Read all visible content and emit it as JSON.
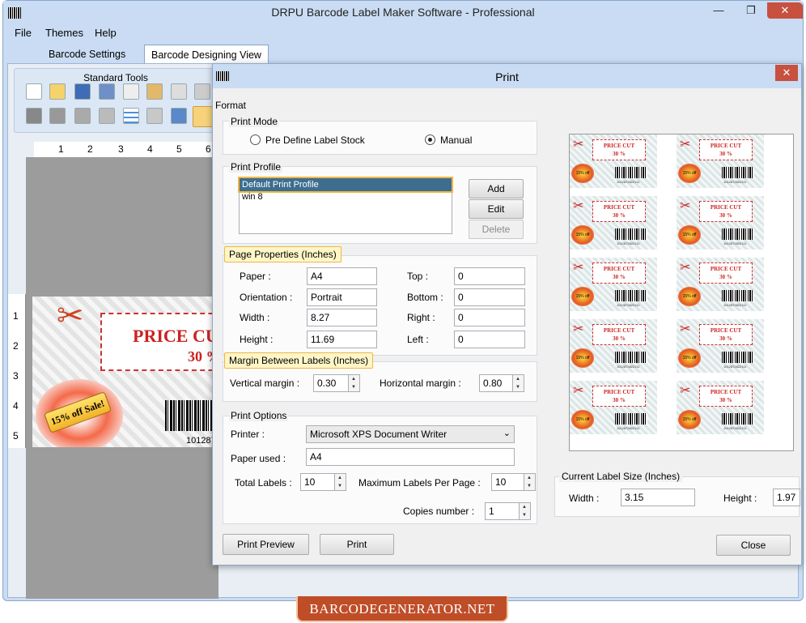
{
  "window": {
    "title": "DRPU Barcode Label Maker Software - Professional",
    "minimize": "—",
    "maximize": "❐",
    "close": "✕"
  },
  "menu": [
    "File",
    "Themes",
    "Help"
  ],
  "tabs": [
    "Barcode Settings",
    "Barcode Designing View"
  ],
  "toolbox": {
    "title": "Standard Tools"
  },
  "ruler": {
    "h": [
      "1",
      "2",
      "3",
      "4",
      "5",
      "6"
    ],
    "v": [
      "1",
      "2",
      "3",
      "4",
      "5"
    ]
  },
  "label_design": {
    "price_text": "PRICE CU",
    "percent": "30 %",
    "badge": "15% off Sale!",
    "barcode_number": "101287"
  },
  "print": {
    "title": "Print",
    "close_x": "✕",
    "format_label": "Format",
    "mode": {
      "title": "Print Mode",
      "option1": "Pre Define Label Stock",
      "option2": "Manual",
      "selected": "Manual"
    },
    "profile": {
      "title": "Print Profile",
      "items": [
        "Default Print Profile",
        "win 8"
      ],
      "add": "Add",
      "edit": "Edit",
      "delete": "Delete"
    },
    "page": {
      "title": "Page Properties (Inches)",
      "paper_label": "Paper :",
      "paper": "A4",
      "orientation_label": "Orientation :",
      "orientation": "Portrait",
      "width_label": "Width :",
      "width": "8.27",
      "height_label": "Height :",
      "height": "11.69",
      "top_label": "Top :",
      "top": "0",
      "bottom_label": "Bottom :",
      "bottom": "0",
      "right_label": "Right :",
      "right": "0",
      "left_label": "Left :",
      "left": "0"
    },
    "margin": {
      "title": "Margin Between Labels (Inches)",
      "vertical_label": "Vertical margin :",
      "vertical": "0.30",
      "horizontal_label": "Horizontal margin :",
      "horizontal": "0.80"
    },
    "options": {
      "title": "Print Options",
      "printer_label": "Printer :",
      "printer": "Microsoft XPS Document Writer",
      "paper_used_label": "Paper used :",
      "paper_used": "A4",
      "total_label": "Total Labels :",
      "total": "10",
      "max_label": "Maximum Labels Per Page :",
      "max": "10",
      "copies_label": "Copies number :",
      "copies": "1"
    },
    "buttons": {
      "preview": "Print Preview",
      "print": "Print",
      "close": "Close"
    },
    "current_size": {
      "title": "Current Label Size (Inches)",
      "width_label": "Width :",
      "width": "3.15",
      "height_label": "Height :",
      "height": "1.97"
    },
    "preview_label": {
      "price": "PRICE CUT",
      "percent": "30 %",
      "badge": "15% off Sale!",
      "number": "1012872822111"
    }
  },
  "watermark": "BARCODEGENERATOR.NET"
}
